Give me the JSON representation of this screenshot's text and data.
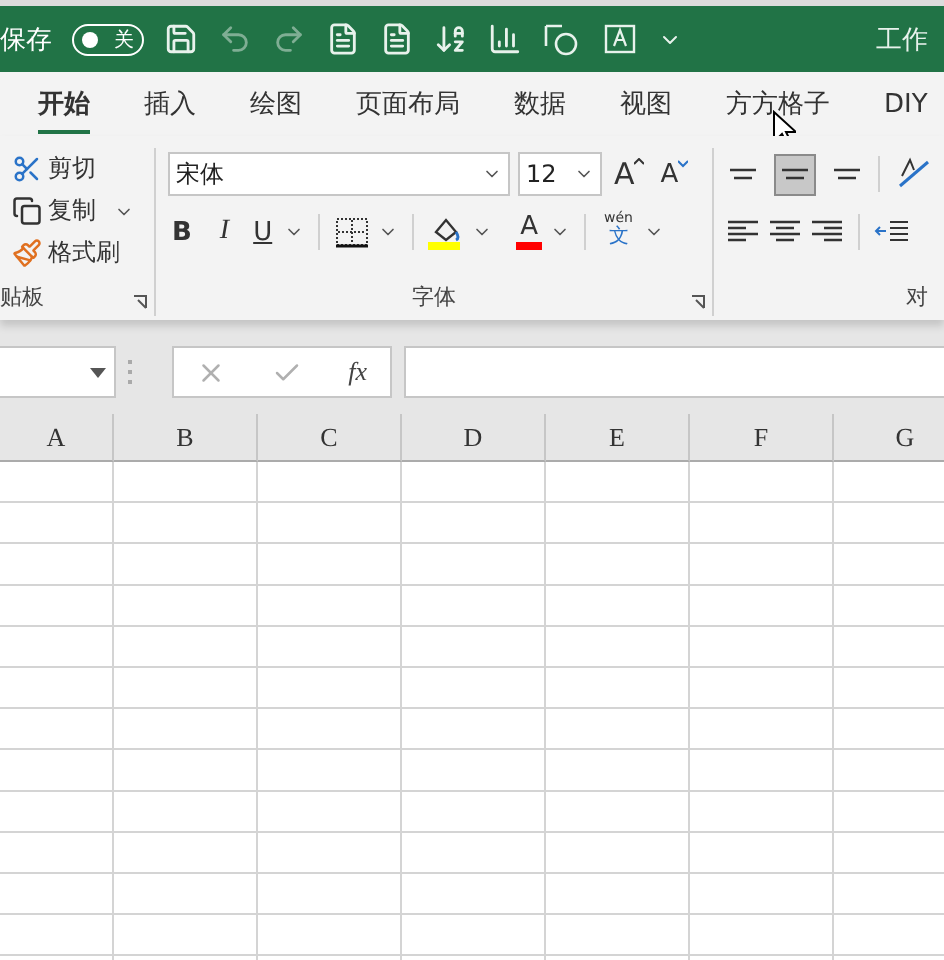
{
  "title_bar": {
    "autosave_label": "保存",
    "autosave_toggle": {
      "on": false,
      "label": "关"
    },
    "title": "工作"
  },
  "tabs": [
    {
      "label": "开始",
      "selected": true
    },
    {
      "label": "插入",
      "selected": false
    },
    {
      "label": "绘图",
      "selected": false
    },
    {
      "label": "页面布局",
      "selected": false
    },
    {
      "label": "数据",
      "selected": false
    },
    {
      "label": "视图",
      "selected": false
    },
    {
      "label": "方方格子",
      "selected": false
    },
    {
      "label": "DIY",
      "selected": false
    }
  ],
  "clipboard": {
    "items": [
      {
        "kind": "cut",
        "label": "剪切",
        "dropdown": false
      },
      {
        "kind": "copy",
        "label": "复制",
        "dropdown": true
      },
      {
        "kind": "painter",
        "label": "格式刷",
        "dropdown": false
      }
    ],
    "group_label": "贴板"
  },
  "font": {
    "name": "宋体",
    "size": "12",
    "grow": "A",
    "shrink": "A",
    "bold": "B",
    "italic": "I",
    "underline": "U",
    "font_color": "A",
    "phonetic_top": "wén",
    "phonetic_bottom": "文",
    "group_label": "字体"
  },
  "alignment": {
    "vertical": [
      {
        "kind": "top",
        "selected": false
      },
      {
        "kind": "middle",
        "selected": true
      },
      {
        "kind": "bottom",
        "selected": false
      }
    ],
    "group_label": "对"
  },
  "formula_bar": {
    "function_label": "fx"
  },
  "columns": [
    "A",
    "B",
    "C",
    "D",
    "E",
    "F",
    "G"
  ]
}
